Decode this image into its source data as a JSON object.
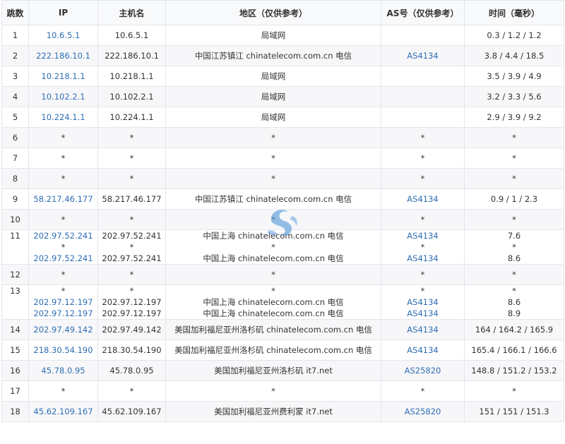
{
  "headers": [
    "跳数",
    "IP",
    "主机名",
    "地区（仅供参考）",
    "AS号（仅供参考）",
    "时间（毫秒）"
  ],
  "colors": {
    "link": "#2f6eb5",
    "border": "#e3e6ea",
    "stripe": "#f7f7f9",
    "watermark": "#5a9bd8"
  },
  "rows": [
    {
      "hop": "1",
      "lines": [
        {
          "ip": "10.6.5.1",
          "host": "10.6.5.1",
          "region": "局域网",
          "as": "",
          "time": "0.3 / 1.2 / 1.2"
        }
      ]
    },
    {
      "hop": "2",
      "lines": [
        {
          "ip": "222.186.10.1",
          "host": "222.186.10.1",
          "region": "中国江苏镇江 chinatelecom.com.cn 电信",
          "as": "AS4134",
          "time": "3.8 / 4.4 / 18.5"
        }
      ]
    },
    {
      "hop": "3",
      "lines": [
        {
          "ip": "10.218.1.1",
          "host": "10.218.1.1",
          "region": "局域网",
          "as": "",
          "time": "3.5 / 3.9 / 4.9"
        }
      ]
    },
    {
      "hop": "4",
      "lines": [
        {
          "ip": "10.102.2.1",
          "host": "10.102.2.1",
          "region": "局域网",
          "as": "",
          "time": "3.2 / 3.3 / 5.6"
        }
      ]
    },
    {
      "hop": "5",
      "lines": [
        {
          "ip": "10.224.1.1",
          "host": "10.224.1.1",
          "region": "局域网",
          "as": "",
          "time": "2.9 / 3.9 / 9.2"
        }
      ]
    },
    {
      "hop": "6",
      "lines": [
        {
          "ip": "*",
          "host": "*",
          "region": "*",
          "as": "*",
          "time": "*"
        }
      ]
    },
    {
      "hop": "7",
      "lines": [
        {
          "ip": "*",
          "host": "*",
          "region": "*",
          "as": "*",
          "time": "*"
        }
      ]
    },
    {
      "hop": "8",
      "lines": [
        {
          "ip": "*",
          "host": "*",
          "region": "*",
          "as": "*",
          "time": "*"
        }
      ]
    },
    {
      "hop": "9",
      "lines": [
        {
          "ip": "58.217.46.177",
          "host": "58.217.46.177",
          "region": "中国江苏镇江 chinatelecom.com.cn 电信",
          "as": "AS4134",
          "time": "0.9 / 1 / 2.3"
        }
      ]
    },
    {
      "hop": "10",
      "lines": [
        {
          "ip": "*",
          "host": "*",
          "region": "*",
          "as": "*",
          "time": "*"
        }
      ]
    },
    {
      "hop": "11",
      "lines": [
        {
          "ip": "202.97.52.241",
          "host": "202.97.52.241",
          "region": "中国上海 chinatelecom.com.cn 电信",
          "as": "AS4134",
          "time": "7.6"
        },
        {
          "ip": "*",
          "host": "*",
          "region": "*",
          "as": "*",
          "time": "*"
        },
        {
          "ip": "202.97.52.241",
          "host": "202.97.52.241",
          "region": "中国上海 chinatelecom.com.cn 电信",
          "as": "AS4134",
          "time": "8.6"
        }
      ]
    },
    {
      "hop": "12",
      "lines": [
        {
          "ip": "*",
          "host": "*",
          "region": "*",
          "as": "*",
          "time": "*"
        }
      ]
    },
    {
      "hop": "13",
      "lines": [
        {
          "ip": "*",
          "host": "*",
          "region": "*",
          "as": "*",
          "time": "*"
        },
        {
          "ip": "202.97.12.197",
          "host": "202.97.12.197",
          "region": "中国上海 chinatelecom.com.cn 电信",
          "as": "AS4134",
          "time": "8.6"
        },
        {
          "ip": "202.97.12.197",
          "host": "202.97.12.197",
          "region": "中国上海 chinatelecom.com.cn 电信",
          "as": "AS4134",
          "time": "8.9"
        }
      ]
    },
    {
      "hop": "14",
      "lines": [
        {
          "ip": "202.97.49.142",
          "host": "202.97.49.142",
          "region": "美国加利福尼亚州洛杉矶 chinatelecom.com.cn 电信",
          "as": "AS4134",
          "time": "164 / 164.2 / 165.9"
        }
      ]
    },
    {
      "hop": "15",
      "lines": [
        {
          "ip": "218.30.54.190",
          "host": "218.30.54.190",
          "region": "美国加利福尼亚州洛杉矶 chinatelecom.com.cn 电信",
          "as": "AS4134",
          "time": "165.4 / 166.1 / 166.6"
        }
      ]
    },
    {
      "hop": "16",
      "lines": [
        {
          "ip": "45.78.0.95",
          "host": "45.78.0.95",
          "region": "美国加利福尼亚州洛杉矶 it7.net",
          "as": "AS25820",
          "time": "148.8 / 151.2 / 153.2"
        }
      ]
    },
    {
      "hop": "17",
      "lines": [
        {
          "ip": "*",
          "host": "*",
          "region": "*",
          "as": "*",
          "time": "*"
        }
      ]
    },
    {
      "hop": "18",
      "lines": [
        {
          "ip": "45.62.109.167",
          "host": "45.62.109.167",
          "region": "美国加利福尼亚州费利蒙 it7.net",
          "as": "AS25820",
          "time": "151 / 151 / 151.3"
        }
      ]
    }
  ]
}
